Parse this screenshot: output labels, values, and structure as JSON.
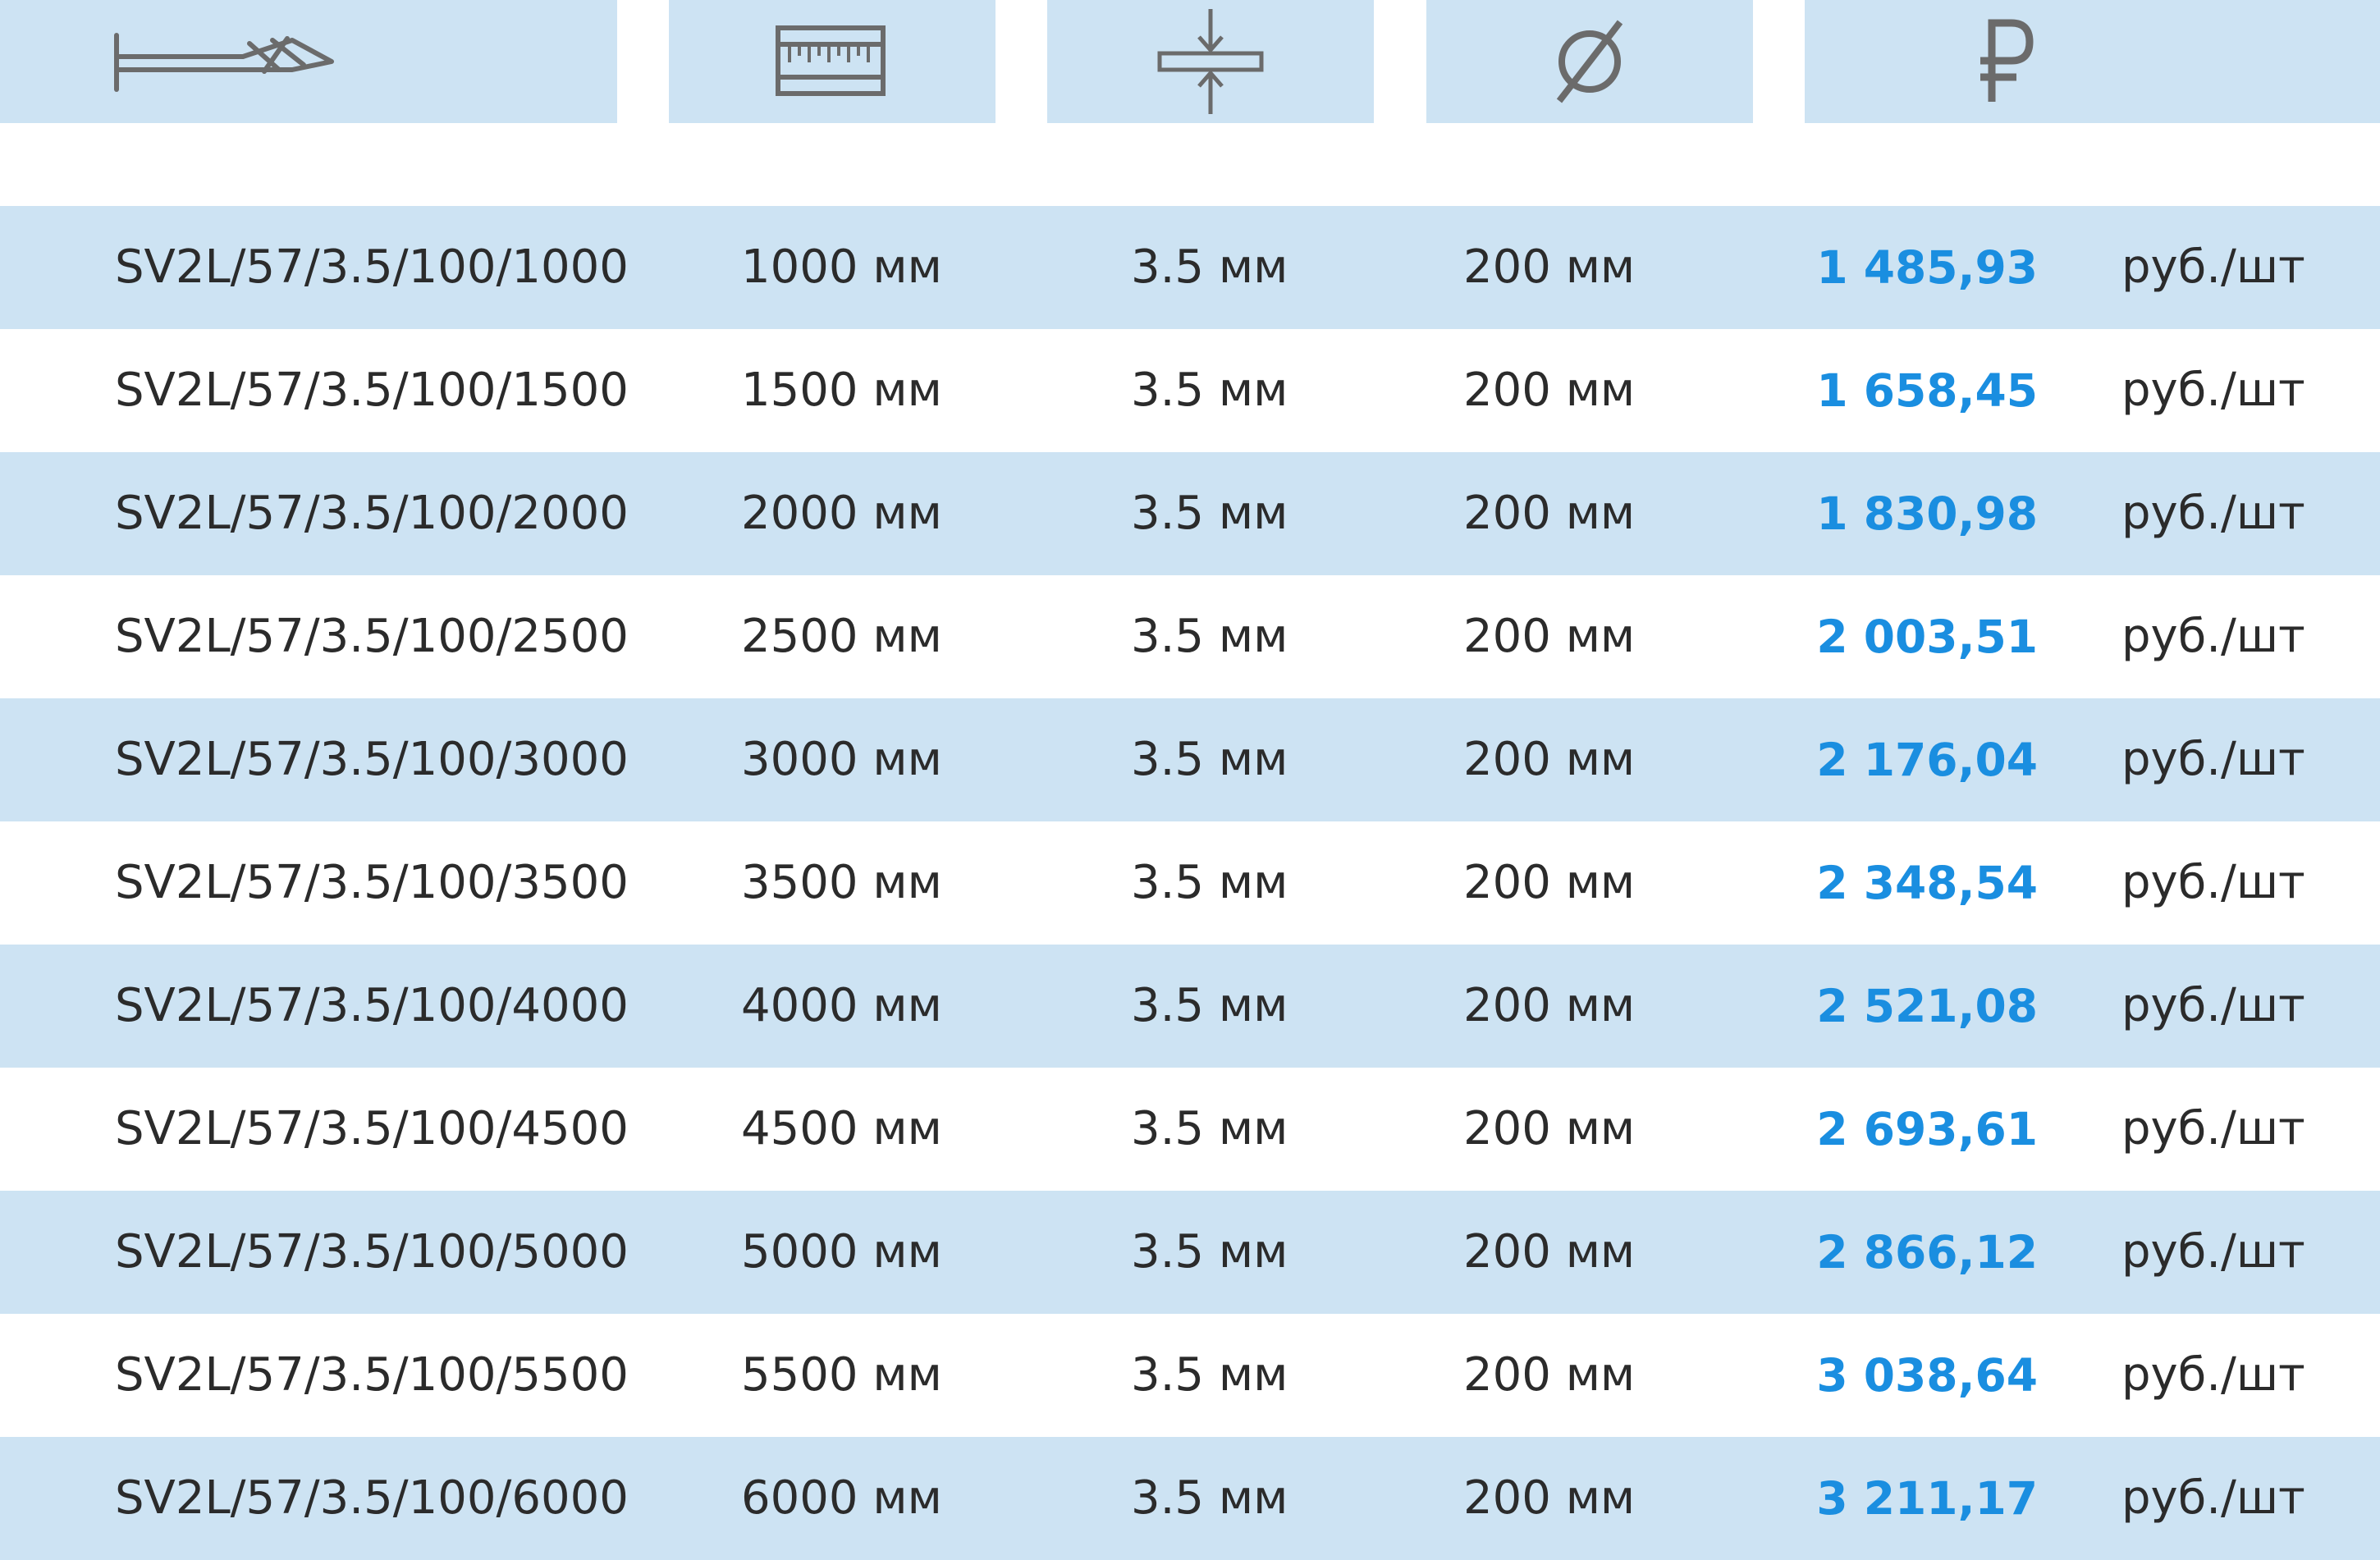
{
  "header": {
    "columns": [
      {
        "icon": "screw-icon"
      },
      {
        "icon": "ruler-icon"
      },
      {
        "icon": "thickness-icon"
      },
      {
        "symbol": "Ø",
        "icon": "diameter-icon"
      },
      {
        "symbol": "₽",
        "icon": "ruble-icon"
      }
    ]
  },
  "colors": {
    "header_bg": "#cde3f3",
    "row_stripe": "#cde3f3",
    "price": "#1a8ee0",
    "text": "#2b2b2b",
    "icon": "#6b6b6b"
  },
  "rows": [
    {
      "article": "SV2L/57/3.5/100/1000",
      "length": "1000 мм",
      "thickness": "3.5 мм",
      "diameter": "200 мм",
      "price": "1 485,93",
      "unit": "руб./шт"
    },
    {
      "article": "SV2L/57/3.5/100/1500",
      "length": "1500 мм",
      "thickness": "3.5 мм",
      "diameter": "200 мм",
      "price": "1 658,45",
      "unit": "руб./шт"
    },
    {
      "article": "SV2L/57/3.5/100/2000",
      "length": "2000 мм",
      "thickness": "3.5 мм",
      "diameter": "200 мм",
      "price": "1 830,98",
      "unit": "руб./шт"
    },
    {
      "article": "SV2L/57/3.5/100/2500",
      "length": "2500 мм",
      "thickness": "3.5 мм",
      "diameter": "200 мм",
      "price": "2 003,51",
      "unit": "руб./шт"
    },
    {
      "article": "SV2L/57/3.5/100/3000",
      "length": "3000 мм",
      "thickness": "3.5 мм",
      "diameter": "200 мм",
      "price": "2 176,04",
      "unit": "руб./шт"
    },
    {
      "article": "SV2L/57/3.5/100/3500",
      "length": "3500 мм",
      "thickness": "3.5 мм",
      "diameter": "200 мм",
      "price": "2 348,54",
      "unit": "руб./шт"
    },
    {
      "article": "SV2L/57/3.5/100/4000",
      "length": "4000 мм",
      "thickness": "3.5 мм",
      "diameter": "200 мм",
      "price": "2 521,08",
      "unit": "руб./шт"
    },
    {
      "article": "SV2L/57/3.5/100/4500",
      "length": "4500 мм",
      "thickness": "3.5 мм",
      "diameter": "200 мм",
      "price": "2 693,61",
      "unit": "руб./шт"
    },
    {
      "article": "SV2L/57/3.5/100/5000",
      "length": "5000 мм",
      "thickness": "3.5 мм",
      "diameter": "200 мм",
      "price": "2 866,12",
      "unit": "руб./шт"
    },
    {
      "article": "SV2L/57/3.5/100/5500",
      "length": "5500 мм",
      "thickness": "3.5 мм",
      "diameter": "200 мм",
      "price": "3 038,64",
      "unit": "руб./шт"
    },
    {
      "article": "SV2L/57/3.5/100/6000",
      "length": "6000 мм",
      "thickness": "3.5 мм",
      "diameter": "200 мм",
      "price": "3 211,17",
      "unit": "руб./шт"
    }
  ]
}
